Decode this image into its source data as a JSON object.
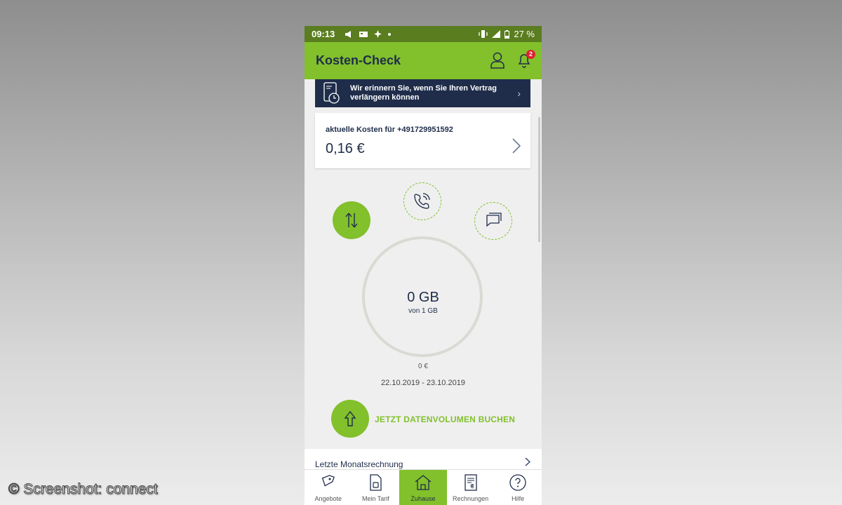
{
  "status": {
    "time": "09:13",
    "battery": "27 %"
  },
  "header": {
    "title": "Kosten-Check",
    "notifications": "2"
  },
  "reminder": {
    "text": "Wir erinnern Sie, wenn Sie Ihren Vertrag verlängern können"
  },
  "costs": {
    "label": "aktuelle Kosten für +491729951592",
    "value": "0,16 €"
  },
  "usage": {
    "value": "0 GB",
    "of": "von 1 GB",
    "cost": "0 €",
    "period": "22.10.2019 - 23.10.2019"
  },
  "book_action": {
    "label": "JETZT DATENVOLUMEN BUCHEN"
  },
  "last_invoice": {
    "label": "Letzte Monatsrechnung"
  },
  "nav": [
    {
      "label": "Angebote",
      "icon": "tag-icon"
    },
    {
      "label": "Mein Tarif",
      "icon": "sim-card-icon"
    },
    {
      "label": "Zuhause",
      "icon": "home-icon"
    },
    {
      "label": "Rechnungen",
      "icon": "invoice-icon"
    },
    {
      "label": "Hilfe",
      "icon": "help-icon"
    }
  ],
  "watermark": "© Screenshot: connect",
  "colors": {
    "brand_green": "#82c02c",
    "status_green": "#5a7d1f",
    "navy": "#1f2d4a",
    "badge_red": "#e0202f"
  }
}
